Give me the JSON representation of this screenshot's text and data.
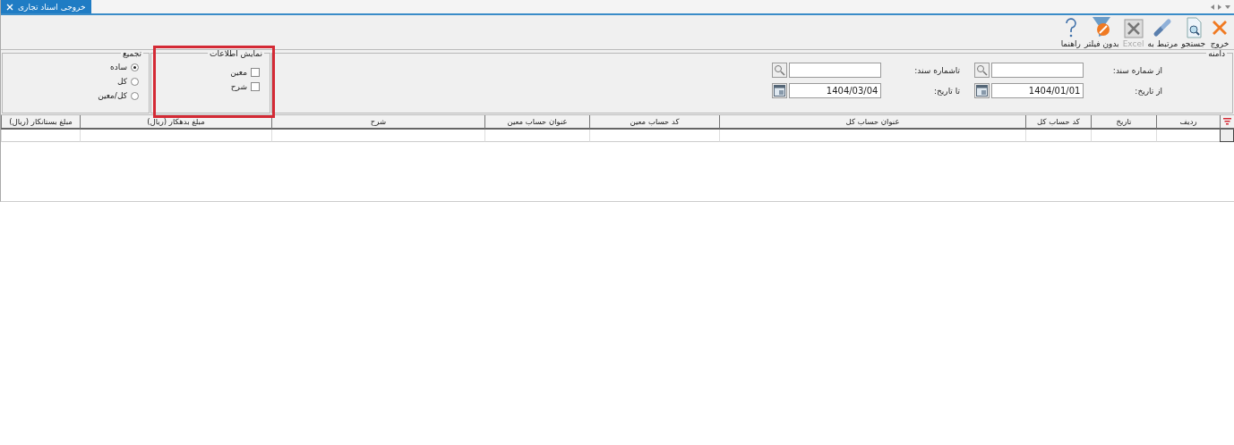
{
  "tab": {
    "title": "خروجی اسناد تجاری",
    "selected": true
  },
  "toolbar": [
    {
      "kind": "exit",
      "label": "خروج",
      "disabled": false
    },
    {
      "kind": "search",
      "label": "جستجو",
      "disabled": false
    },
    {
      "kind": "link",
      "label": "مرتبط به",
      "disabled": false
    },
    {
      "kind": "excel",
      "label": "Excel",
      "disabled": true
    },
    {
      "kind": "filter",
      "label": "بدون فیلتر",
      "disabled": false
    },
    {
      "kind": "help",
      "label": "راهنما",
      "disabled": false
    }
  ],
  "range": {
    "title": "دامنه",
    "fields": [
      {
        "kind": "lookup",
        "label": "از شماره سند:"
      },
      {
        "kind": "lookup",
        "label": "تاشماره سند:"
      },
      {
        "kind": "date",
        "label": "از تاریخ:",
        "value": "1404/01/01"
      },
      {
        "kind": "date",
        "label": "تا تاریخ:",
        "value": "1404/03/04"
      }
    ]
  },
  "display": {
    "title": "نمایش اطلاعات",
    "highlighted": true,
    "options": [
      {
        "label": "معین",
        "checked": false
      },
      {
        "label": "شرح",
        "checked": false
      }
    ]
  },
  "grouping": {
    "title": "تجمیع",
    "options": [
      {
        "label": "ساده",
        "selected": true
      },
      {
        "label": "کل",
        "selected": false
      },
      {
        "label": "کل/معین",
        "selected": false
      }
    ]
  },
  "table": {
    "columns": [
      "ردیف",
      "تاریخ",
      "کد حساب کل",
      "عنوان حساب کل",
      "کد حساب معین",
      "عنوان حساب معین",
      "شرح",
      "مبلغ بدهکار (ریال)",
      "مبلغ بستانکار (ریال)"
    ]
  }
}
